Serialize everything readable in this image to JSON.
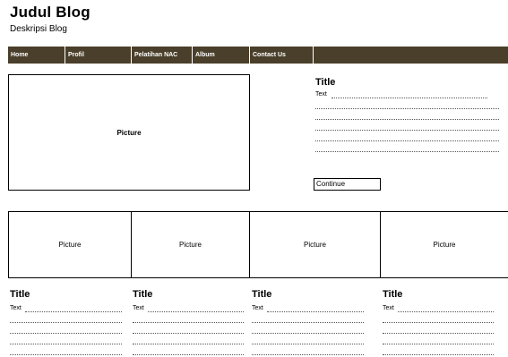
{
  "header": {
    "title": "Judul Blog",
    "description": "Deskripsi Blog"
  },
  "nav": {
    "items": [
      "Home",
      "Profil",
      "Pelatihan NAC",
      "Album",
      "Contact Us"
    ]
  },
  "featured": {
    "picture_label": "Picture",
    "title": "Title",
    "text": "Text",
    "continue_label": "Continue"
  },
  "gallery": [
    {
      "picture_label": "Picture",
      "title": "Title",
      "text": "Text"
    },
    {
      "picture_label": "Picture",
      "title": "Title",
      "text": "Text"
    },
    {
      "picture_label": "Picture",
      "title": "Title",
      "text": "Text"
    },
    {
      "picture_label": "Picture",
      "title": "Title",
      "text": "Text"
    }
  ]
}
